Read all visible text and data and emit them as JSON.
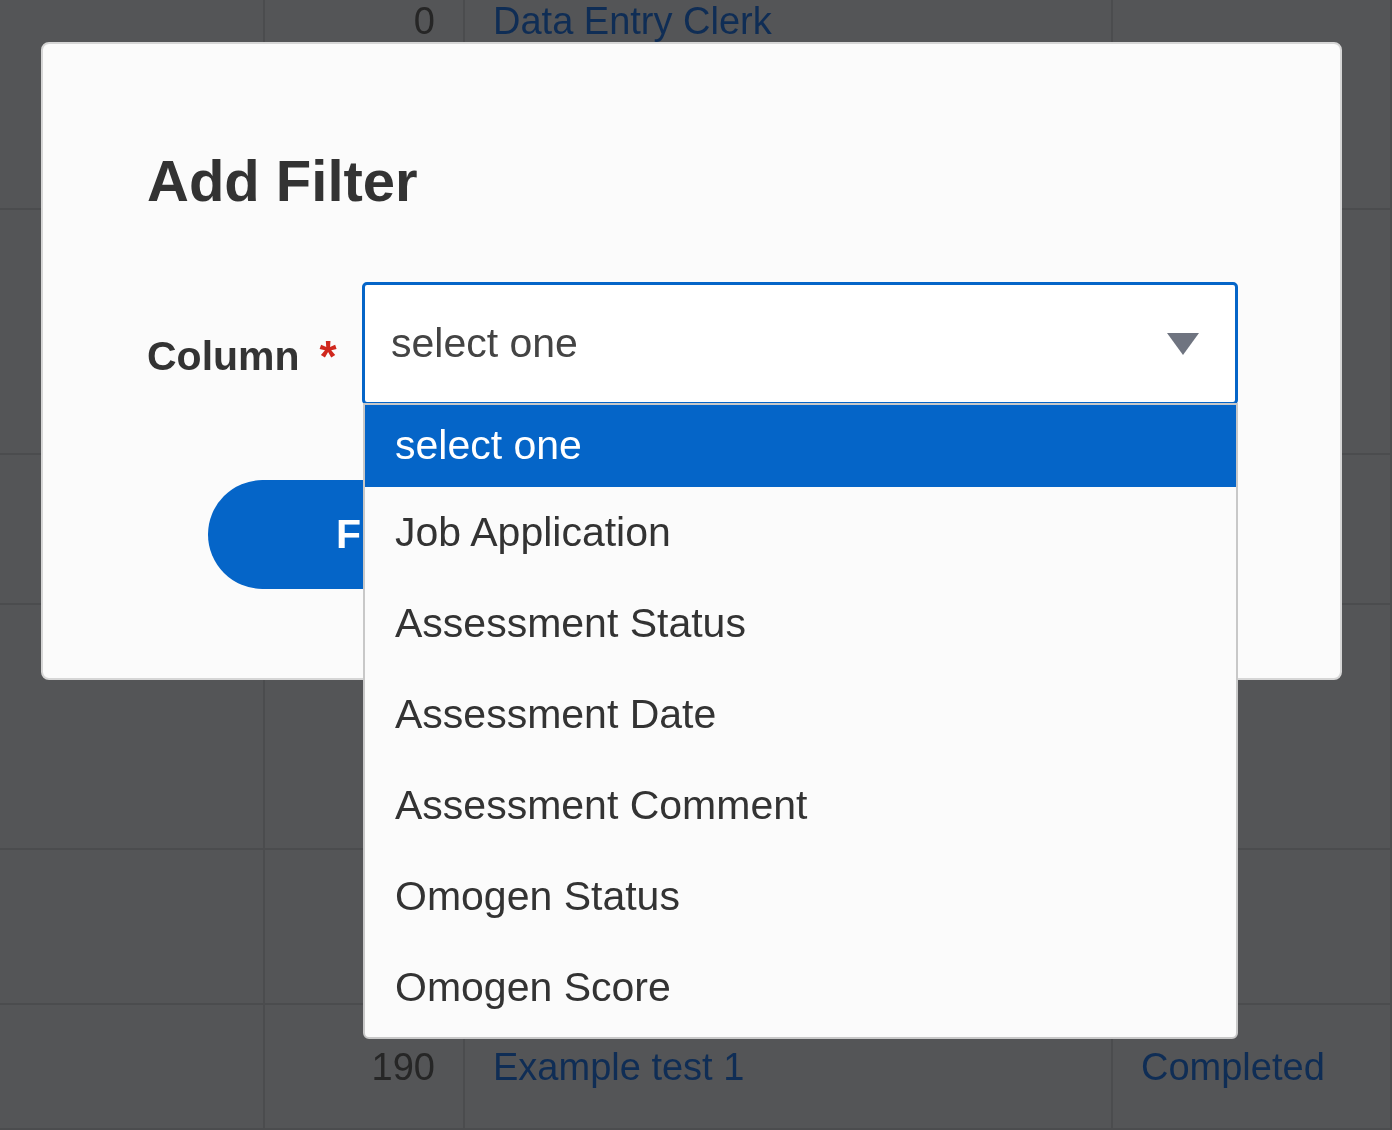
{
  "background_table": {
    "rows": [
      {
        "number": "0",
        "name": "Data Entry Clerk"
      },
      {},
      {},
      {},
      {},
      {
        "number": "190",
        "name": "Example test 1",
        "status": "Completed"
      }
    ]
  },
  "dialog": {
    "title": "Add Filter",
    "field": {
      "label": "Column",
      "required_mark": "*",
      "value": "select one",
      "expanded": true,
      "options": [
        {
          "label": "select one",
          "selected": true
        },
        {
          "label": "Job Application",
          "selected": false
        },
        {
          "label": "Assessment Status",
          "selected": false
        },
        {
          "label": "Assessment Date",
          "selected": false
        },
        {
          "label": "Assessment Comment",
          "selected": false
        },
        {
          "label": "Omogen Status",
          "selected": false
        },
        {
          "label": "Omogen Score",
          "selected": false
        }
      ]
    },
    "button": {
      "label": "F"
    }
  }
}
